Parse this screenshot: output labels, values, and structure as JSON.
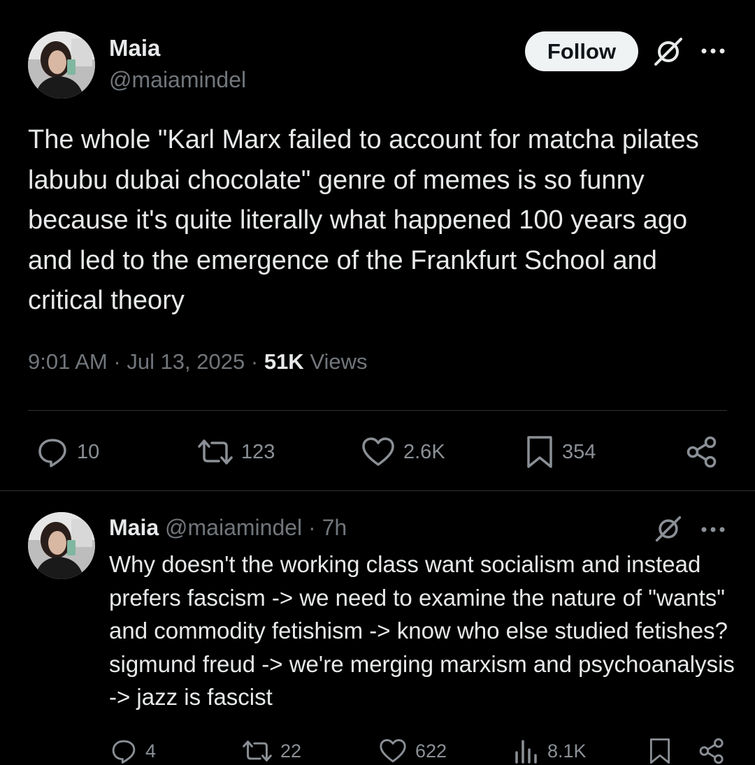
{
  "main_post": {
    "author_name": "Maia",
    "author_handle": "@maiamindel",
    "follow_label": "Follow",
    "text": "The whole \"Karl Marx failed to account for matcha pilates labubu dubai chocolate\" genre of memes is so funny because it's quite literally what happened 100 years ago and led to the emergence of the Frankfurt School and critical theory",
    "time": "9:01 AM",
    "separator": "·",
    "date": "Jul 13, 2025",
    "views_count": "51K",
    "views_label": "Views",
    "replies": "10",
    "reposts": "123",
    "likes": "2.6K",
    "bookmarks": "354"
  },
  "reply": {
    "author_name": "Maia",
    "author_handle": "@maiamindel",
    "separator": "·",
    "time": "7h",
    "text": "Why doesn't the working class want socialism and instead prefers fascism -> we need to examine the nature of \"wants\" and commodity fetishism -> know who else studied fetishes? sigmund freud -> we're merging marxism and psychoanalysis -> jazz is fascist",
    "replies": "4",
    "reposts": "22",
    "likes": "622",
    "views": "8.1K"
  },
  "icons": {
    "reply": "speech-bubble-icon",
    "repost": "repost-icon",
    "like": "heart-icon",
    "bookmark": "bookmark-icon",
    "share": "share-icon",
    "views": "views-bar-icon",
    "grok": "grok-icon",
    "more": "more-dots-icon"
  },
  "colors": {
    "background": "#000000",
    "text_primary": "#e7e9ea",
    "text_secondary": "#71767b",
    "follow_bg": "#eff3f4",
    "divider": "#2f3336"
  }
}
